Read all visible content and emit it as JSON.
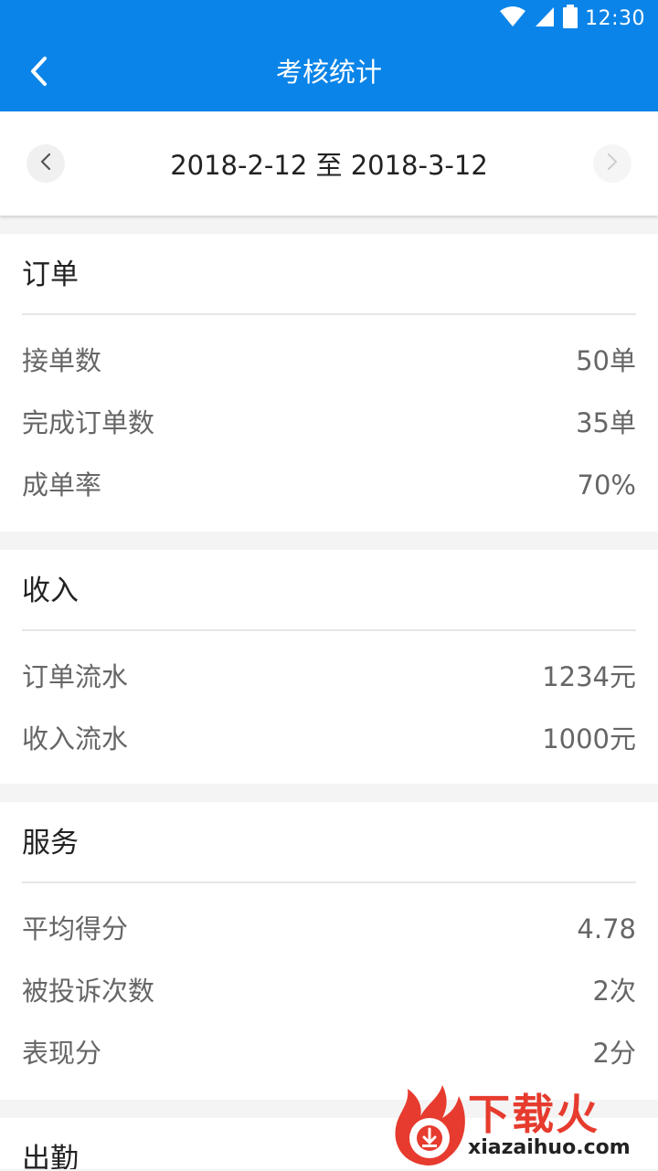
{
  "status_bar": {
    "time": "12:30"
  },
  "header": {
    "title": "考核统计"
  },
  "date_range": {
    "text": "2018-2-12 至 2018-3-12"
  },
  "sections": [
    {
      "title": "订单",
      "rows": [
        {
          "label": "接单数",
          "value": "50单"
        },
        {
          "label": "完成订单数",
          "value": "35单"
        },
        {
          "label": "成单率",
          "value": "70%"
        }
      ]
    },
    {
      "title": "收入",
      "rows": [
        {
          "label": "订单流水",
          "value": "1234元"
        },
        {
          "label": "收入流水",
          "value": "1000元"
        }
      ]
    },
    {
      "title": "服务",
      "rows": [
        {
          "label": "平均得分",
          "value": "4.78"
        },
        {
          "label": "被投诉次数",
          "value": "2次"
        },
        {
          "label": "表现分",
          "value": "2分"
        }
      ]
    },
    {
      "title": "出勤",
      "rows": []
    }
  ],
  "watermark": {
    "brand": "下载火",
    "domain": "xiazaihuo.com"
  },
  "colors": {
    "primary": "#0a84e8",
    "watermark": "#e63b2e"
  }
}
